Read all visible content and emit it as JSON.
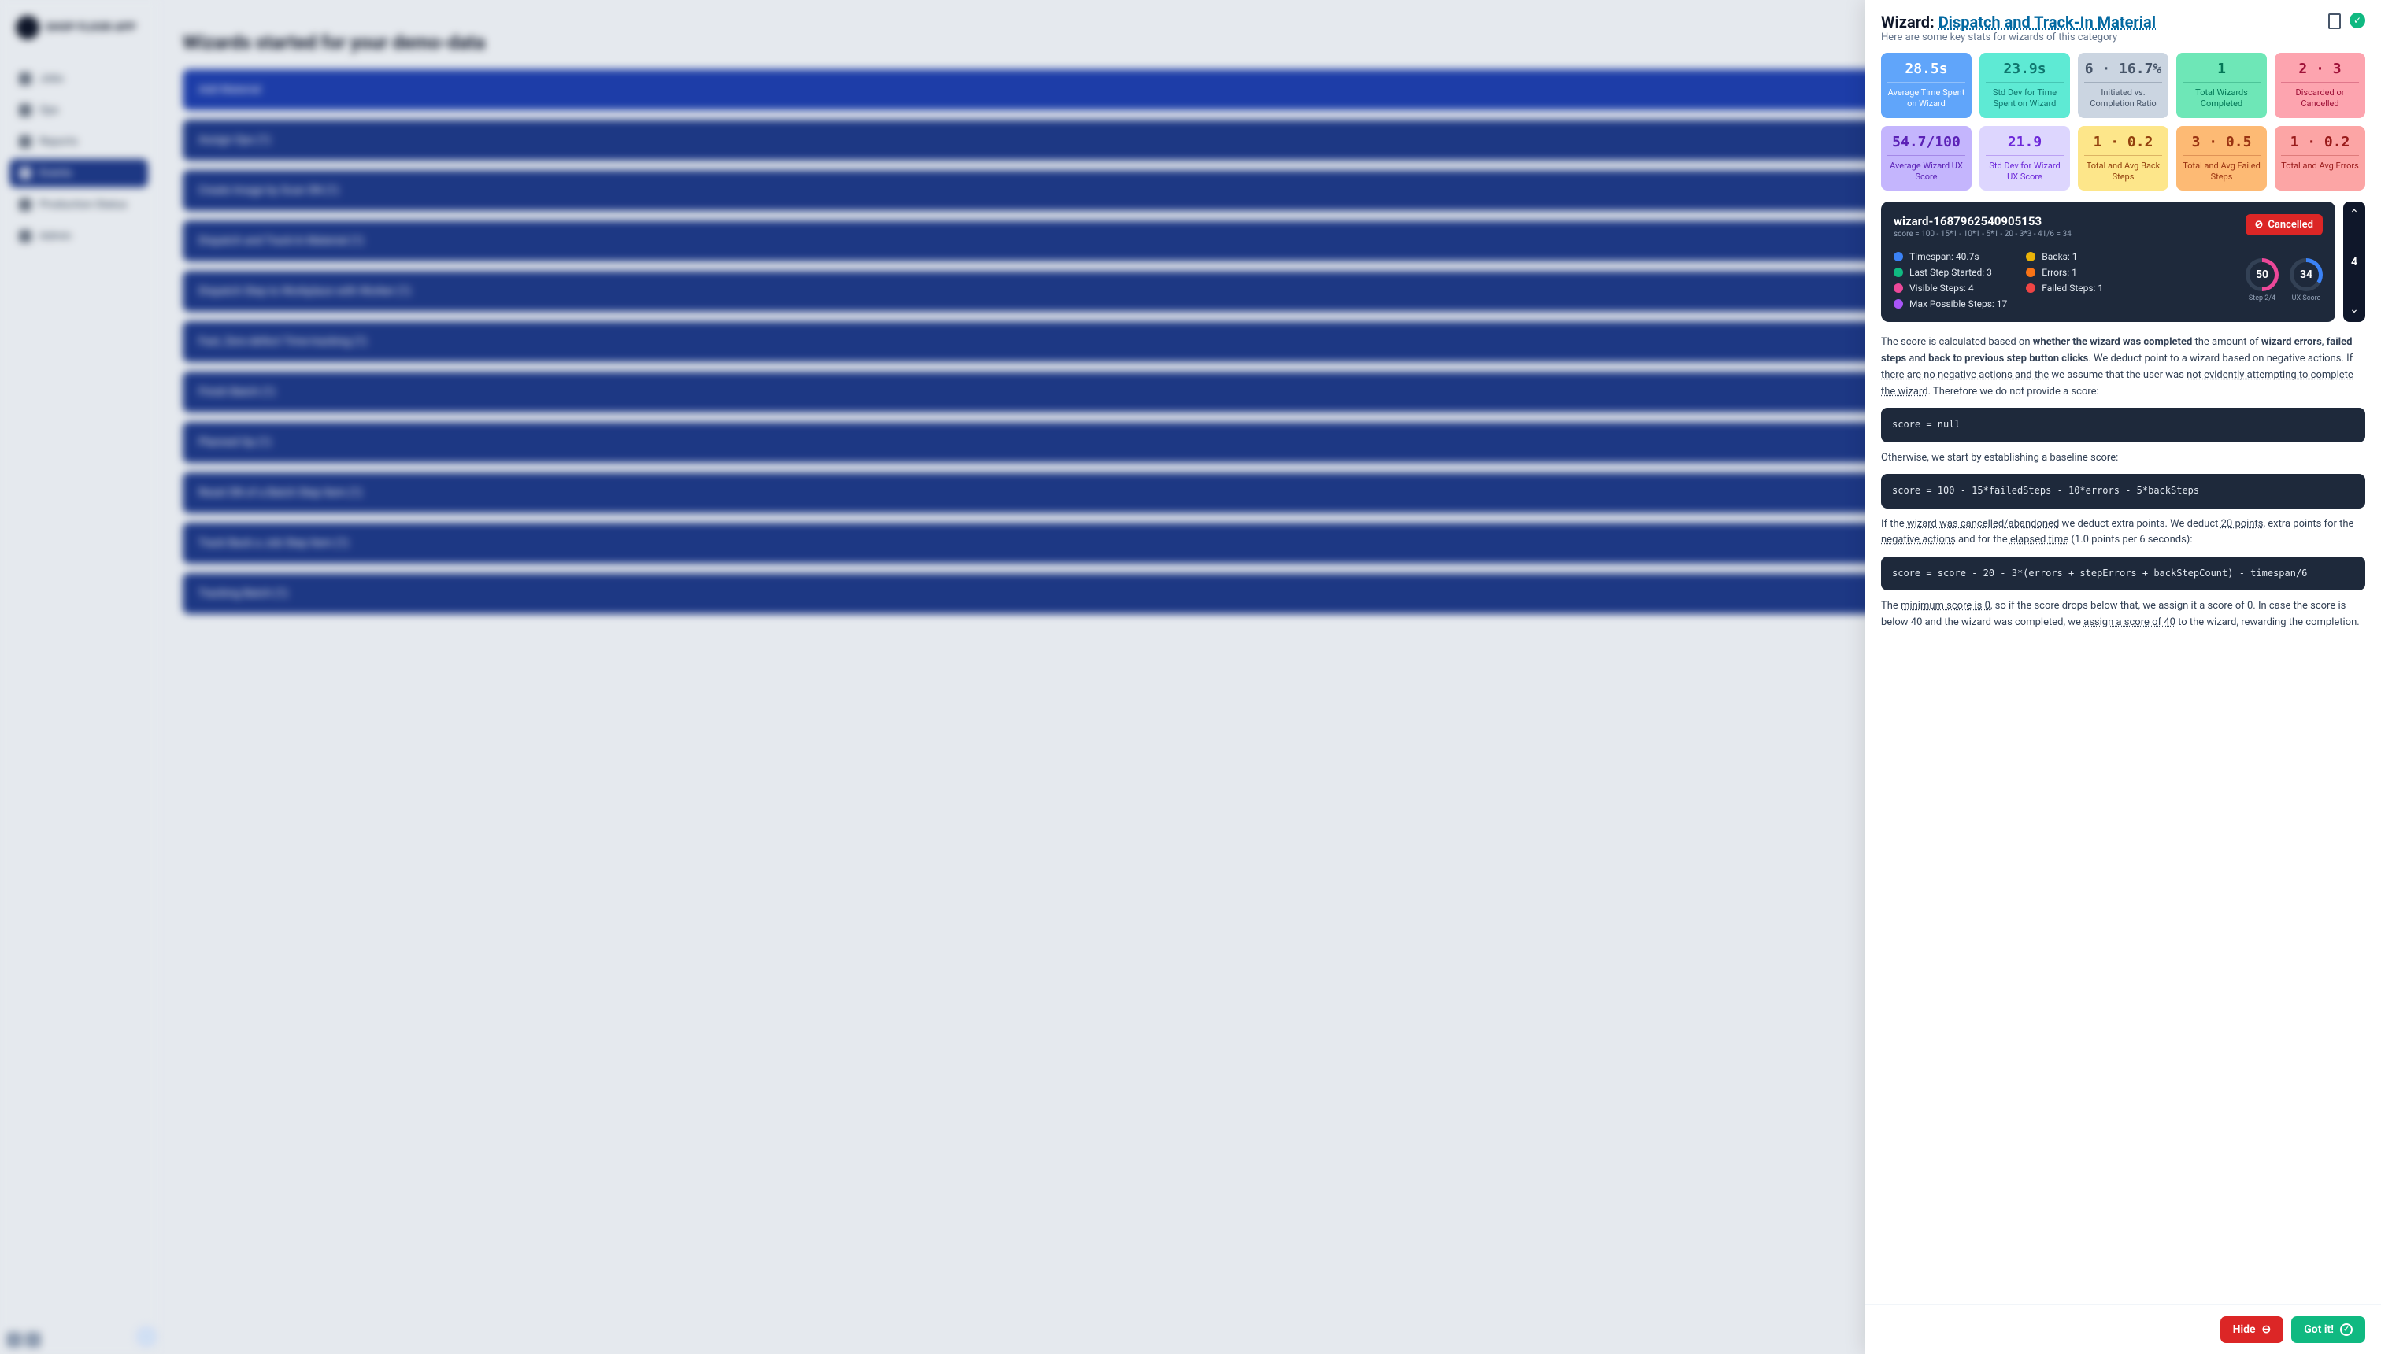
{
  "sidebar": {
    "logo": "SHOP FLOOR APP",
    "items": [
      {
        "label": "Jobs"
      },
      {
        "label": "Ops"
      },
      {
        "label": "Reports"
      },
      {
        "label": "Events"
      },
      {
        "label": "Production Status"
      },
      {
        "label": "Admin"
      }
    ]
  },
  "main": {
    "title": "Wizards started for your demo-data",
    "wizards": [
      "Add Material",
      "Assign Ops (1)",
      "Create Image by Scan SN (1)",
      "Dispatch and Track-In Material (1)",
      "Dispatch Step to Workplace with Worker (1)",
      "Fast, Zero-defect Time-tracking (1)",
      "Finish Batch (1)",
      "Planned Op (1)",
      "Reset SN of a Batch Step Item (1)",
      "Track Back a Job Step Item (1)",
      "Tracking Batch (1)"
    ]
  },
  "panel": {
    "title_prefix": "Wizard: ",
    "title_link": "Dispatch and Track-In Material",
    "subtitle": "Here are some key stats for wizards of this category",
    "stats": [
      {
        "v": "28.5s",
        "l": "Average Time Spent on Wizard",
        "c": "c-blue"
      },
      {
        "v": "23.9s",
        "l": "Std Dev for Time Spent on Wizard",
        "c": "c-teal"
      },
      {
        "v": "6 · 16.7%",
        "l": "Initiated vs. Completion Ratio",
        "c": "c-gray"
      },
      {
        "v": "1",
        "l": "Total Wizards Completed",
        "c": "c-green"
      },
      {
        "v": "2 · 3",
        "l": "Discarded or Cancelled",
        "c": "c-pink"
      },
      {
        "v": "54.7/100",
        "l": "Average Wizard UX Score",
        "c": "c-purple"
      },
      {
        "v": "21.9",
        "l": "Std Dev for Wizard UX Score",
        "c": "c-lav"
      },
      {
        "v": "1 · 0.2",
        "l": "Total and Avg Back Steps",
        "c": "c-yellow"
      },
      {
        "v": "3 · 0.5",
        "l": "Total and Avg Failed Steps",
        "c": "c-orange"
      },
      {
        "v": "1 · 0.2",
        "l": "Total and Avg Errors",
        "c": "c-red"
      }
    ],
    "detail": {
      "id": "wizard-1687962540905153",
      "formula": "score = 100 - 15*1 - 10*1 - 5*1 - 20 - 3*3 - 41/6 = 34",
      "badge": "Cancelled",
      "metrics_left": [
        {
          "c": "#3b82f6",
          "t": "Timespan: 40.7s"
        },
        {
          "c": "#10b981",
          "t": "Last Step Started: 3"
        },
        {
          "c": "#ec4899",
          "t": "Visible Steps: 4"
        },
        {
          "c": "#a855f7",
          "t": "Max Possible Steps: 17"
        }
      ],
      "metrics_right": [
        {
          "c": "#eab308",
          "t": "Backs: 1"
        },
        {
          "c": "#f97316",
          "t": "Errors: 1"
        },
        {
          "c": "#ef4444",
          "t": "Failed Steps: 1"
        }
      ],
      "gauge1": {
        "v": "50",
        "l": "Step 2/4"
      },
      "gauge2": {
        "v": "34",
        "l": "UX Score"
      },
      "nav_count": "4"
    },
    "explain": {
      "p1a": "The score is calculated based on ",
      "p1b": "whether the wizard was completed",
      "p1c": " the amount of ",
      "p1d": "wizard errors",
      "p1e": ", ",
      "p1f": "failed steps",
      "p1g": " and ",
      "p1h": "back to previous step button clicks",
      "p1i": ". We deduct point to a wizard based on negative actions. If ",
      "p1j": "there are no negative actions and the",
      "p1k": " we assume that the user was ",
      "p1l": "not evidently attempting to complete the wizard",
      "p1m": ". Therefore we do not provide a score:",
      "code1": "score = null",
      "p2": "Otherwise, we start by establishing a baseline score:",
      "code2": "score = 100 - 15*failedSteps - 10*errors - 5*backSteps",
      "p3a": "If the ",
      "p3b": "wizard was cancelled/abandoned",
      "p3c": " we deduct extra points. We deduct ",
      "p3d": "20 points",
      "p3e": ", extra points for the ",
      "p3f": "negative actions",
      "p3g": " and for the ",
      "p3h": "elapsed time",
      "p3i": " (1.0 points per 6 seconds):",
      "code3": "score = score - 20 - 3*(errors + stepErrors + backStepCount) - timespan/6",
      "p4a": "The ",
      "p4b": "minimum score is 0",
      "p4c": ", so if the score drops below that, we assign it a score of 0. In case the score is below 40 and the wizard was completed, we ",
      "p4d": "assign a score of 40",
      "p4e": " to the wizard, rewarding the completion."
    },
    "footer": {
      "hide": "Hide",
      "got": "Got it!"
    }
  }
}
